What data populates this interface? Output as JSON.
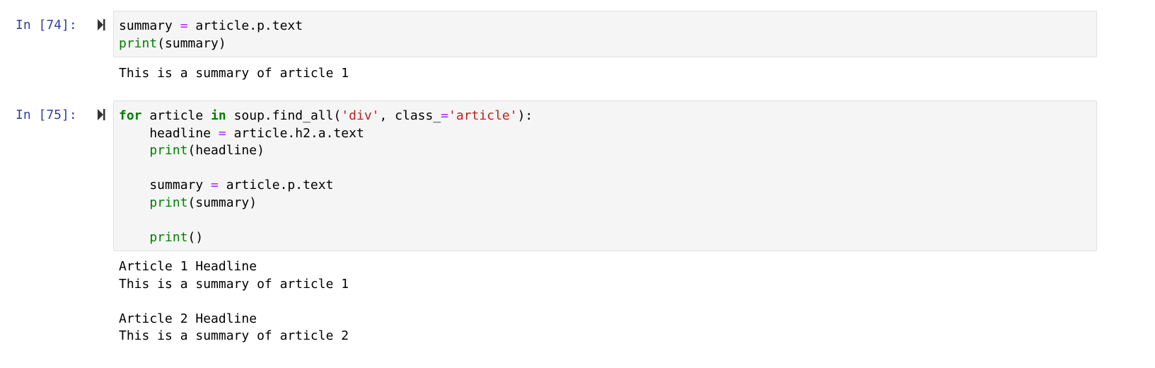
{
  "cells": [
    {
      "prompt": "In [74]:",
      "code": [
        [
          {
            "t": "summary ",
            "c": ""
          },
          {
            "t": "=",
            "c": "op"
          },
          {
            "t": " article.p.text",
            "c": ""
          }
        ],
        [
          {
            "t": "print",
            "c": "bi"
          },
          {
            "t": "(summary)",
            "c": ""
          }
        ]
      ],
      "output": [
        "This is a summary of article 1"
      ]
    },
    {
      "prompt": "In [75]:",
      "code": [
        [
          {
            "t": "for",
            "c": "kw"
          },
          {
            "t": " article ",
            "c": ""
          },
          {
            "t": "in",
            "c": "kw"
          },
          {
            "t": " soup.find_all(",
            "c": ""
          },
          {
            "t": "'div'",
            "c": "str"
          },
          {
            "t": ", class_",
            "c": ""
          },
          {
            "t": "=",
            "c": "op"
          },
          {
            "t": "'article'",
            "c": "str"
          },
          {
            "t": "):",
            "c": ""
          }
        ],
        [
          {
            "t": "    headline ",
            "c": ""
          },
          {
            "t": "=",
            "c": "op"
          },
          {
            "t": " article.h2.a.text",
            "c": ""
          }
        ],
        [
          {
            "t": "    ",
            "c": ""
          },
          {
            "t": "print",
            "c": "bi"
          },
          {
            "t": "(headline)",
            "c": ""
          }
        ],
        [],
        [
          {
            "t": "    summary ",
            "c": ""
          },
          {
            "t": "=",
            "c": "op"
          },
          {
            "t": " article.p.text",
            "c": ""
          }
        ],
        [
          {
            "t": "    ",
            "c": ""
          },
          {
            "t": "print",
            "c": "bi"
          },
          {
            "t": "(summary)",
            "c": ""
          }
        ],
        [],
        [
          {
            "t": "    ",
            "c": ""
          },
          {
            "t": "print",
            "c": "bi"
          },
          {
            "t": "()",
            "c": ""
          }
        ]
      ],
      "output": [
        "Article 1 Headline",
        "This is a summary of article 1",
        "",
        "Article 2 Headline",
        "This is a summary of article 2"
      ]
    }
  ],
  "icons": {
    "run": "run-cell-icon"
  },
  "colors": {
    "prompt": "#303f9f",
    "keyword": "#008000",
    "operator": "#aa22ff",
    "string": "#ba2121",
    "cell_bg": "#f5f5f5"
  }
}
